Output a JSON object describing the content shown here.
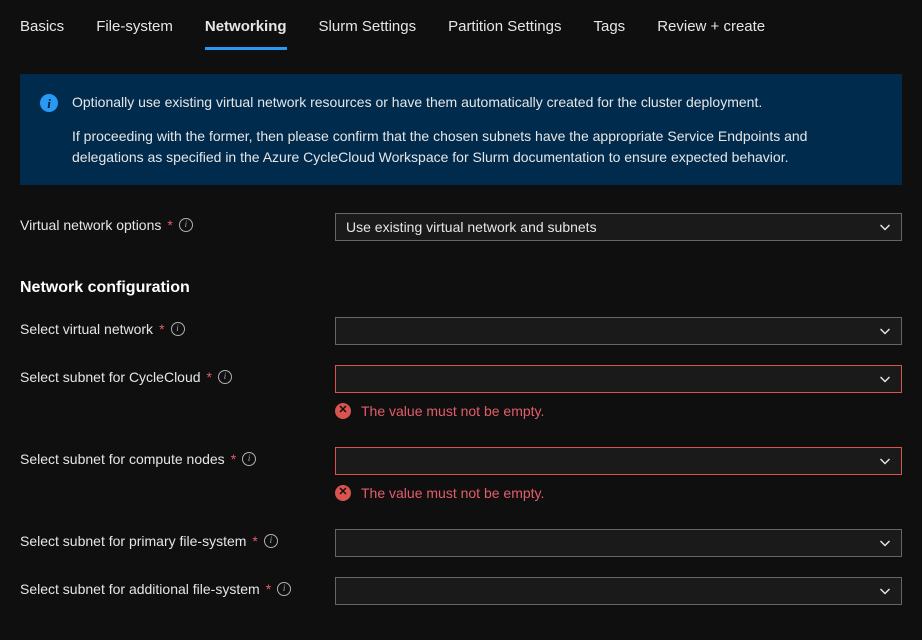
{
  "tabs": [
    {
      "label": "Basics"
    },
    {
      "label": "File-system"
    },
    {
      "label": "Networking"
    },
    {
      "label": "Slurm Settings"
    },
    {
      "label": "Partition Settings"
    },
    {
      "label": "Tags"
    },
    {
      "label": "Review + create"
    }
  ],
  "activeTabIndex": 2,
  "info": {
    "line1": "Optionally use existing virtual network resources or have them automatically created for the cluster deployment.",
    "line2": "If proceeding with the former, then please confirm that the chosen subnets have the appropriate Service Endpoints and delegations as specified in the Azure CycleCloud Workspace for Slurm documentation to ensure expected behavior."
  },
  "fields": {
    "vnetOptions": {
      "label": "Virtual network options",
      "required": true,
      "hint": true,
      "value": "Use existing virtual network and subnets",
      "error": null
    }
  },
  "sectionTitle": "Network configuration",
  "configFields": [
    {
      "id": "select-vnet",
      "label": "Select virtual network",
      "required": true,
      "hint": true,
      "value": "",
      "error": null
    },
    {
      "id": "select-subnet-cyclecloud",
      "label": "Select subnet for CycleCloud",
      "required": true,
      "hint": true,
      "value": "",
      "error": "The value must not be empty."
    },
    {
      "id": "select-subnet-compute",
      "label": "Select subnet for compute nodes",
      "required": true,
      "hint": true,
      "value": "",
      "error": "The value must not be empty."
    },
    {
      "id": "select-subnet-primary-fs",
      "label": "Select subnet for primary file-system",
      "required": true,
      "hint": true,
      "value": "",
      "error": null
    },
    {
      "id": "select-subnet-additional-fs",
      "label": "Select subnet for additional file-system",
      "required": true,
      "hint": true,
      "value": "",
      "error": null
    }
  ],
  "errorMessage": "The value must not be empty."
}
